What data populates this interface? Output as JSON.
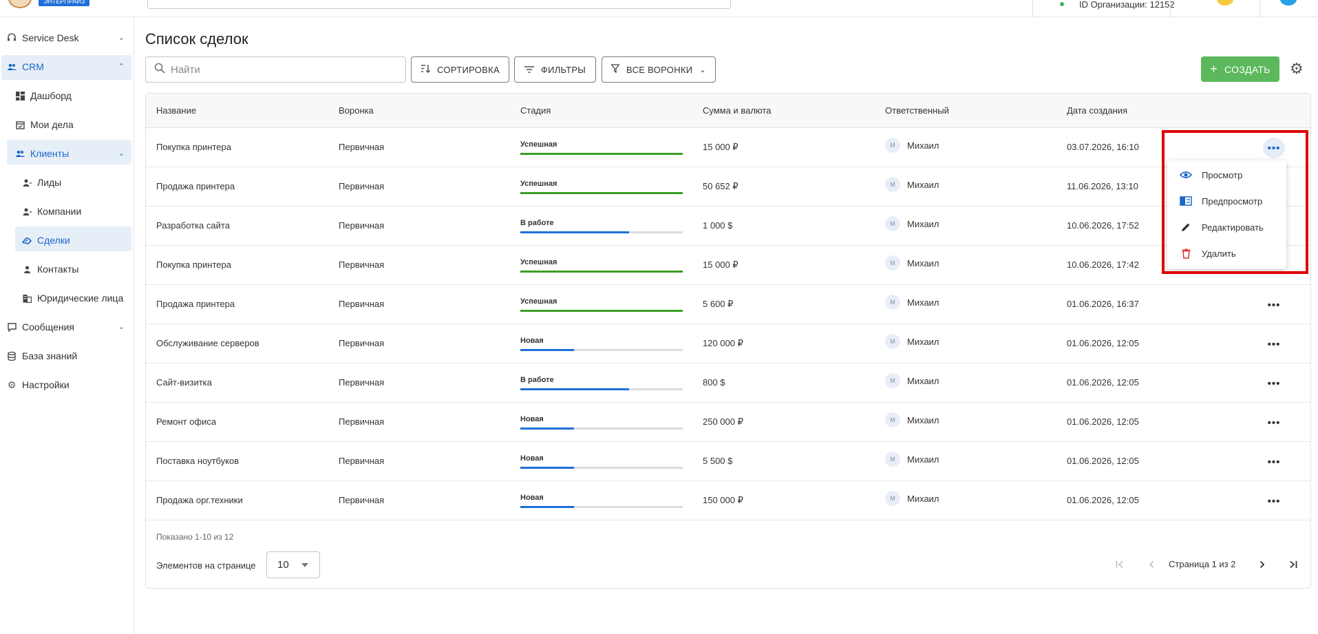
{
  "topbar": {
    "edition_badge": "ЭНТЕРПРАЙЗ",
    "org_id": "ID Организации: 12152"
  },
  "sidebar": {
    "items": [
      {
        "label": "Service Desk",
        "icon": "headset-icon"
      },
      {
        "label": "CRM",
        "icon": "people-icon"
      },
      {
        "label": "Дашборд",
        "icon": "dashboard-icon"
      },
      {
        "label": "Мои дела",
        "icon": "calendar-check-icon"
      },
      {
        "label": "Клиенты",
        "icon": "clients-icon"
      },
      {
        "label": "Лиды",
        "icon": "person-add-icon"
      },
      {
        "label": "Компании",
        "icon": "person-add-icon"
      },
      {
        "label": "Сделки",
        "icon": "handshake-icon"
      },
      {
        "label": "Контакты",
        "icon": "person-icon"
      },
      {
        "label": "Юридические лица",
        "icon": "building-icon"
      },
      {
        "label": "Сообщения",
        "icon": "chat-icon"
      },
      {
        "label": "База знаний",
        "icon": "database-icon"
      },
      {
        "label": "Настройки",
        "icon": "gear-icon"
      }
    ]
  },
  "page": {
    "title": "Список сделок",
    "search_placeholder": "Найти",
    "sort_label": "СОРТИРОВКА",
    "filters_label": "ФИЛЬТРЫ",
    "funnels_label": "ВСЕ ВОРОНКИ",
    "create_label": "СОЗДАТЬ"
  },
  "table": {
    "columns": [
      "Название",
      "Воронка",
      "Стадия",
      "Сумма и валюта",
      "Ответственный",
      "Дата создания"
    ],
    "rows": [
      {
        "name": "Покупка принтера",
        "funnel": "Первичная",
        "stage": "Успешная",
        "progress": 1.0,
        "sum": "15 000 ₽",
        "owner": "Михаил",
        "owner_initial": "М",
        "date": "03.07.2026, 16:10"
      },
      {
        "name": "Продажа принтера",
        "funnel": "Первичная",
        "stage": "Успешная",
        "progress": 1.0,
        "sum": "50 652 ₽",
        "owner": "Михаил",
        "owner_initial": "М",
        "date": "11.06.2026, 13:10"
      },
      {
        "name": "Разработка сайта",
        "funnel": "Первичная",
        "stage": "В работе",
        "progress": 0.67,
        "sum": "1 000 $",
        "owner": "Михаил",
        "owner_initial": "М",
        "date": "10.06.2026, 17:52"
      },
      {
        "name": "Покупка принтера",
        "funnel": "Первичная",
        "stage": "Успешная",
        "progress": 1.0,
        "sum": "15 000 ₽",
        "owner": "Михаил",
        "owner_initial": "М",
        "date": "10.06.2026, 17:42"
      },
      {
        "name": "Продажа принтера",
        "funnel": "Первичная",
        "stage": "Успешная",
        "progress": 1.0,
        "sum": "5 600 ₽",
        "owner": "Михаил",
        "owner_initial": "М",
        "date": "01.06.2026, 16:37"
      },
      {
        "name": "Обслуживание серверов",
        "funnel": "Первичная",
        "stage": "Новая",
        "progress": 0.33,
        "sum": "120 000 ₽",
        "owner": "Михаил",
        "owner_initial": "М",
        "date": "01.06.2026, 12:05"
      },
      {
        "name": "Сайт-визитка",
        "funnel": "Первичная",
        "stage": "В работе",
        "progress": 0.67,
        "sum": "800 $",
        "owner": "Михаил",
        "owner_initial": "М",
        "date": "01.06.2026, 12:05"
      },
      {
        "name": "Ремонт офиса",
        "funnel": "Первичная",
        "stage": "Новая",
        "progress": 0.33,
        "sum": "250 000 ₽",
        "owner": "Михаил",
        "owner_initial": "М",
        "date": "01.06.2026, 12:05"
      },
      {
        "name": "Поставка ноутбуков",
        "funnel": "Первичная",
        "stage": "Новая",
        "progress": 0.33,
        "sum": "5 500 $",
        "owner": "Михаил",
        "owner_initial": "М",
        "date": "01.06.2026, 12:05"
      },
      {
        "name": "Продажа орг.техники",
        "funnel": "Первичная",
        "stage": "Новая",
        "progress": 0.33,
        "sum": "150 000 ₽",
        "owner": "Михаил",
        "owner_initial": "М",
        "date": "01.06.2026, 12:05"
      }
    ],
    "shown_text": "Показано 1-10 из 12",
    "per_page_label": "Элементов на странице",
    "per_page_value": "10",
    "page_info": "Страница 1 из 2"
  },
  "context_menu": {
    "items": [
      {
        "label": "Просмотр",
        "icon": "eye-icon"
      },
      {
        "label": "Предпросмотр",
        "icon": "preview-panel-icon"
      },
      {
        "label": "Редактировать",
        "icon": "pencil-icon"
      },
      {
        "label": "Удалить",
        "icon": "trash-icon"
      }
    ]
  },
  "colors": {
    "accent": "#1b66c9",
    "success": "#3a9d23",
    "progress": "#1e6fd9",
    "create": "#5cb85c",
    "highlight": "#e00000",
    "delete": "#e03030"
  }
}
